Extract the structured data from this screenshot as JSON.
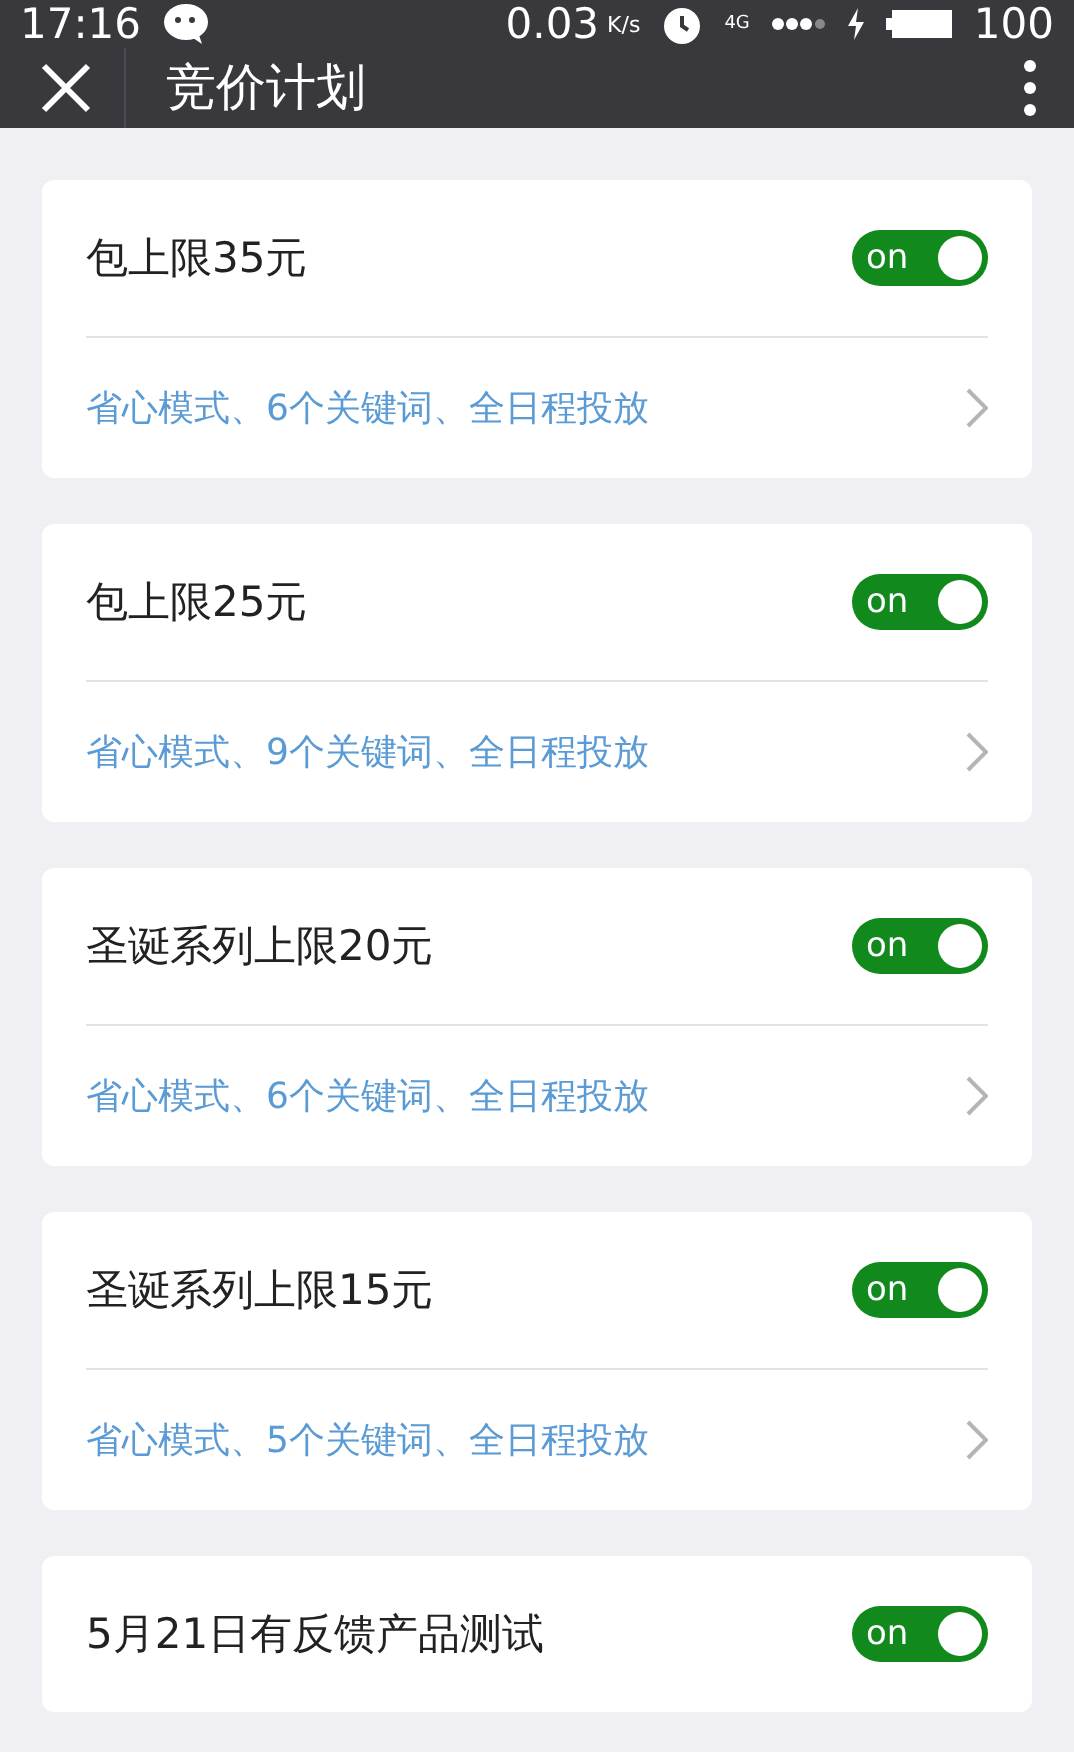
{
  "status_bar": {
    "time": "17:16",
    "speed": "0.03",
    "speed_unit": "K/s",
    "network": "4G",
    "battery": "100"
  },
  "header": {
    "title": "竞价计划"
  },
  "plans": [
    {
      "title": "包上限35元",
      "on": true,
      "toggle_label": "on",
      "detail": "省心模式、6个关键词、全日程投放"
    },
    {
      "title": "包上限25元",
      "on": true,
      "toggle_label": "on",
      "detail": "省心模式、9个关键词、全日程投放"
    },
    {
      "title": "圣诞系列上限20元",
      "on": true,
      "toggle_label": "on",
      "detail": "省心模式、6个关键词、全日程投放"
    },
    {
      "title": "圣诞系列上限15元",
      "on": true,
      "toggle_label": "on",
      "detail": "省心模式、5个关键词、全日程投放"
    },
    {
      "title": "5月21日有反馈产品测试",
      "on": true,
      "toggle_label": "on"
    }
  ]
}
